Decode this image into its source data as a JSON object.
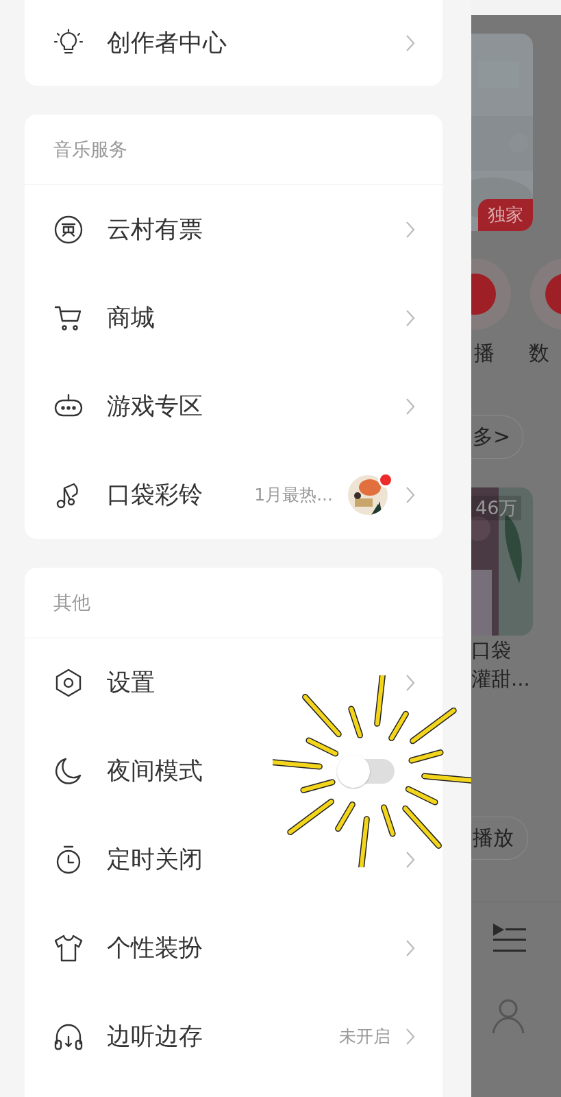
{
  "drawer": {
    "top_item": {
      "label": "创作者中心"
    },
    "sections": [
      {
        "title": "音乐服务",
        "items": [
          {
            "kind": "link",
            "label": "云村有票"
          },
          {
            "kind": "link",
            "label": "商城"
          },
          {
            "kind": "link",
            "label": "游戏专区"
          },
          {
            "kind": "link",
            "label": "口袋彩铃",
            "detail": "1月最热...",
            "thumbnail": {
              "kind": "picture",
              "badge": true
            }
          }
        ]
      },
      {
        "title": "其他",
        "items": [
          {
            "kind": "link",
            "label": "设置"
          },
          {
            "kind": "toggle",
            "label": "夜间模式",
            "on": false
          },
          {
            "kind": "link",
            "label": "定时关闭"
          },
          {
            "kind": "link",
            "label": "个性装扮"
          },
          {
            "kind": "link",
            "label": "边听边存",
            "detail": "未开启"
          }
        ]
      }
    ]
  },
  "background": {
    "tag": "独家",
    "shortcut_labels": [
      "播",
      "数"
    ],
    "more": "多>",
    "play_count": "46万",
    "playlist_lines": [
      "口袋",
      "灌甜..."
    ],
    "play_button": "播放"
  }
}
